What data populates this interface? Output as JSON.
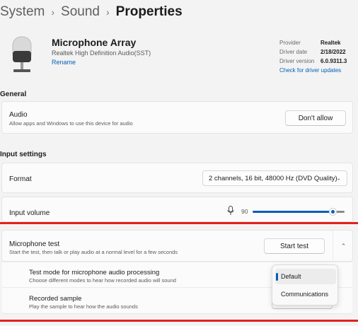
{
  "breadcrumb": {
    "part1": "System",
    "part2": "Sound",
    "current": "Properties",
    "separator": "›"
  },
  "device": {
    "name": "Microphone Array",
    "driver_line": "Realtek High Definition Audio(SST)",
    "rename_label": "Rename",
    "icon": "microphone-device-icon"
  },
  "properties": {
    "provider_label": "Provider",
    "provider_value": "Realtek",
    "driver_date_label": "Driver date",
    "driver_date_value": "2/18/2022",
    "driver_version_label": "Driver version",
    "driver_version_value": "6.0.9311.3",
    "check_updates_label": "Check for driver updates"
  },
  "general": {
    "heading": "General",
    "audio_title": "Audio",
    "audio_desc": "Allow apps and Windows to use this device for audio",
    "dont_allow_label": "Don't allow"
  },
  "input_settings": {
    "heading": "Input settings",
    "format_label": "Format",
    "format_value": "2 channels, 16 bit, 48000 Hz (DVD Quality)",
    "volume_label": "Input volume",
    "volume_value": "90",
    "volume_level": 90
  },
  "mic_test": {
    "title": "Microphone test",
    "desc": "Start the test, then talk or play audio at a normal level for a few seconds",
    "start_label": "Start test",
    "mode_title": "Test mode for microphone audio processing",
    "mode_desc": "Choose different modes to hear how recorded audio will sound",
    "sample_title": "Recorded sample",
    "sample_desc": "Play the sample to hear how the audio sounds",
    "mode_options": [
      "Default",
      "Communications"
    ],
    "selected_mode": "Default"
  },
  "colors": {
    "accent": "#005fb8",
    "highlight_line": "#e2211c",
    "background": "#f3f3f3"
  }
}
